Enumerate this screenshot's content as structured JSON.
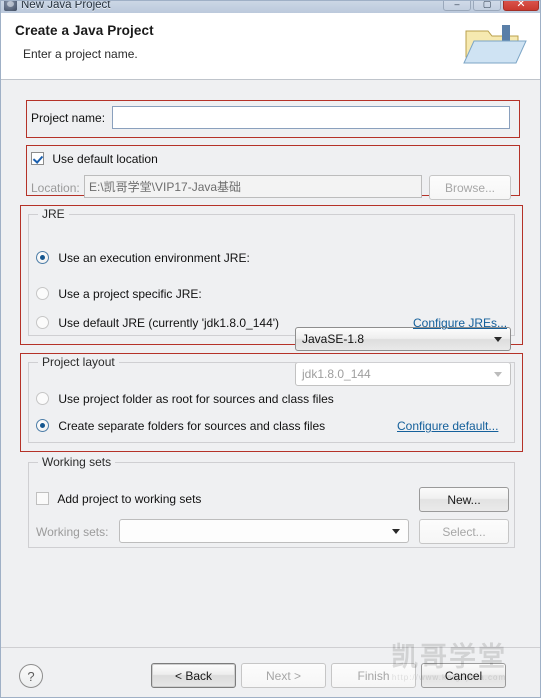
{
  "window": {
    "title": "New Java Project",
    "icon": "java-project-icon",
    "controls": {
      "minimize": "–",
      "maximize": "▢",
      "close": "✕"
    }
  },
  "header": {
    "title": "Create a Java Project",
    "subtitle": "Enter a project name.",
    "icon": "new-java-project-folder-icon"
  },
  "project_name": {
    "label": "Project name:",
    "value": "",
    "placeholder": ""
  },
  "location": {
    "use_default_label": "Use default location",
    "use_default_checked": true,
    "label": "Location:",
    "value": "E:\\凯哥学堂\\VIP17-Java基础",
    "browse_label": "Browse..."
  },
  "jre": {
    "group_title": "JRE",
    "option_execution_env": "Use an execution environment JRE:",
    "execution_env_value": "JavaSE-1.8",
    "option_project_specific": "Use a project specific JRE:",
    "project_specific_value": "jdk1.8.0_144",
    "option_default": "Use default JRE (currently 'jdk1.8.0_144')",
    "configure_link": "Configure JREs...",
    "selected": "execution_env"
  },
  "project_layout": {
    "group_title": "Project layout",
    "option_root": "Use project folder as root for sources and class files",
    "option_separate": "Create separate folders for sources and class files",
    "configure_link": "Configure default...",
    "selected": "separate"
  },
  "working_sets": {
    "group_title": "Working sets",
    "add_label": "Add project to working sets",
    "add_checked": false,
    "label": "Working sets:",
    "value": "",
    "new_label": "New...",
    "select_label": "Select..."
  },
  "footer": {
    "help": "?",
    "back": "< Back",
    "next": "Next >",
    "finish": "Finish",
    "cancel": "Cancel"
  },
  "watermark": {
    "main": "凯哥学堂",
    "sub": "http://www.kaigejava.com"
  },
  "colors": {
    "annotation": "#b53228",
    "link": "#15609b",
    "dialog_bg": "#eff0f2",
    "header_bg": "#ffffff",
    "titlebar": "#c5d1e1",
    "close_button": "#d9534a"
  }
}
